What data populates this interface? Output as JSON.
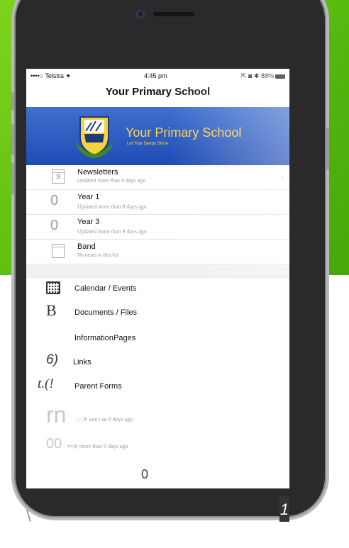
{
  "status_bar": {
    "carrier": "••••○ Telstra ✦",
    "time": "4:45 pm",
    "right": "⇱ ◙ ✱ 88%"
  },
  "nav": {
    "title": "Your Primary School"
  },
  "banner": {
    "title": "Your Primary School",
    "subtitle": "Let Your Deeds Shine"
  },
  "news_list": [
    {
      "icon_text": "9",
      "title": "Newsletters",
      "subtitle": "Updated more than 9 days ago",
      "has_chevron": true
    },
    {
      "icon_text": "0",
      "title": "Year 1",
      "subtitle": "Updated more than 9 days ago"
    },
    {
      "icon_text": "0",
      "title": "Year 3",
      "subtitle": "Updated more than 9 days ago"
    },
    {
      "icon_text": "",
      "title": "Band",
      "subtitle": "No news in this list"
    }
  ],
  "menu": [
    {
      "icon": "calendar-grid-icon",
      "label": "Calendar / Events"
    },
    {
      "icon_glyph": "B",
      "label": "Documents / Files"
    },
    {
      "icon_glyph": "",
      "label": "InformationPages"
    },
    {
      "icon_glyph": "6)",
      "label": "Links"
    },
    {
      "icon_glyph": "t.(!",
      "label": "Parent Forms"
    }
  ],
  "garbled": [
    {
      "glyph": "rn",
      "text": ": :: 9: oee t ao 9 days ago"
    },
    {
      "glyph": "00",
      "text": "•:•:l( more thao 9 days ago"
    }
  ],
  "bottom": {
    "zero": "0",
    "slash": "\\",
    "one": "1"
  }
}
